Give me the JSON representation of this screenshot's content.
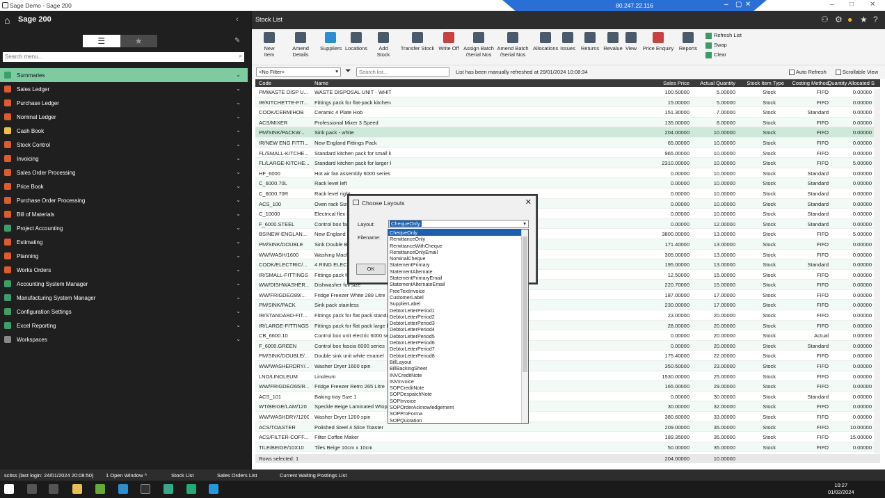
{
  "window": {
    "title": "Sage Demo - Sage 200",
    "ip": "80.247.22.116"
  },
  "sidebar": {
    "title": "Sage 200",
    "search_placeholder": "Search menu...",
    "items": [
      {
        "label": "Summaries",
        "color": "#3aa06a"
      },
      {
        "label": "Sales Ledger",
        "color": "#e05a2a"
      },
      {
        "label": "Purchase Ledger",
        "color": "#e05a2a"
      },
      {
        "label": "Nominal Ledger",
        "color": "#e05a2a"
      },
      {
        "label": "Cash Book",
        "color": "#f0c040"
      },
      {
        "label": "Stock Control",
        "color": "#e05a2a"
      },
      {
        "label": "Invoicing",
        "color": "#e05a2a"
      },
      {
        "label": "Sales Order Processing",
        "color": "#e05a2a"
      },
      {
        "label": "Price Book",
        "color": "#e05a2a"
      },
      {
        "label": "Purchase Order Processing",
        "color": "#e05a2a"
      },
      {
        "label": "Bill of Materials",
        "color": "#e05a2a"
      },
      {
        "label": "Project Accounting",
        "color": "#3aa06a"
      },
      {
        "label": "Estimating",
        "color": "#e05a2a"
      },
      {
        "label": "Planning",
        "color": "#e05a2a"
      },
      {
        "label": "Works Orders",
        "color": "#e05a2a"
      },
      {
        "label": "Accounting System Manager",
        "color": "#3aa06a"
      },
      {
        "label": "Manufacturing System Manager",
        "color": "#3aa06a"
      },
      {
        "label": "Configuration Settings",
        "color": "#3aa06a"
      },
      {
        "label": "Excel Reporting",
        "color": "#3aa06a"
      },
      {
        "label": "Workspaces",
        "color": "#888888"
      }
    ]
  },
  "main": {
    "title": "Stock List",
    "toolbar": [
      "New Item",
      "Amend Details",
      "Suppliers",
      "Locations",
      "Add Stock",
      "Transfer Stock",
      "Write Off",
      "Assign Batch /Serial Nos",
      "Amend Batch /Serial Nos",
      "Allocations",
      "Issues",
      "Returns",
      "Revalue",
      "View",
      "Price Enquiry",
      "Reports"
    ],
    "side_actions": [
      "Refresh List",
      "Swap",
      "Clear"
    ],
    "filter": "<No Filter>",
    "search_placeholder": "Search list...",
    "refresh_info": "List has been manually refreshed at 29/01/2024 10:08:34",
    "auto_refresh": "Auto Refresh",
    "scrollable_view": "Scrollable View"
  },
  "grid": {
    "headers": [
      "Code",
      "Name",
      "Sales Price",
      "Actual Quantity",
      "Stock Item Type",
      "Costing Method",
      "Quantity Allocated S"
    ],
    "rows": [
      [
        "PMWASTE DISP U...",
        "WASTE DISPOSAL UNIT - WHITE",
        "100.50000",
        "5.00000",
        "Stock",
        "FIFO",
        "0.00000"
      ],
      [
        "IR/KITCHETTE-FIT...",
        "Fittings pack for flat-pack kitchenette",
        "15.00000",
        "5.00000",
        "Stock",
        "FIFO",
        "0.00000"
      ],
      [
        "COOK/CERM/HOB",
        "Ceramic 4 Plate Hob",
        "151.30000",
        "7.00000",
        "Stock",
        "Standard",
        "0.00000"
      ],
      [
        "ACS/MIXER",
        "Professional Mixer 3 Speed",
        "135.00000",
        "8.00000",
        "Stock",
        "FIFO",
        "0.00000"
      ],
      [
        "PM/SINK/PACKW...",
        "Sink pack - white",
        "204.00000",
        "10.00000",
        "Stock",
        "FIFO",
        "0.00000"
      ],
      [
        "IR/NEW ENG FITTI...",
        "New England Fittings Pack",
        "65.00000",
        "10.00000",
        "Stock",
        "FIFO",
        "0.00000"
      ],
      [
        "FL/SMALL-KITCHE...",
        "Standard kitchen pack for small kitchen",
        "965.00000",
        "10.00000",
        "Stock",
        "FIFO",
        "0.00000"
      ],
      [
        "FL/LARGE-KITCHE...",
        "Standard kitchen pack for larger kitchens",
        "2310.00000",
        "10.00000",
        "Stock",
        "FIFO",
        "5.00000"
      ],
      [
        "HF_6000",
        "Hot air fan assembly 6000 series",
        "0.00000",
        "10.00000",
        "Stock",
        "Standard",
        "0.00000"
      ],
      [
        "C_6000.70L",
        "Rack level left",
        "0.00000",
        "10.00000",
        "Stock",
        "Standard",
        "0.00000"
      ],
      [
        "C_6000.70R",
        "Rack level right",
        "0.00000",
        "10.00000",
        "Stock",
        "Standard",
        "0.00000"
      ],
      [
        "ACS_100",
        "Oven rack Size",
        "0.00000",
        "10.00000",
        "Stock",
        "Standard",
        "0.00000"
      ],
      [
        "C_10000",
        "Electrical flex 3",
        "0.00000",
        "10.00000",
        "Stock",
        "Standard",
        "0.00000"
      ],
      [
        "F_6000.STEEL",
        "Control box fa",
        "0.00000",
        "12.00000",
        "Stock",
        "Standard",
        "0.00000"
      ],
      [
        "BS/NEW-ENGLAN...",
        "New England B",
        "3800.00000",
        "13.00000",
        "Stock",
        "FIFO",
        "5.00000"
      ],
      [
        "PM/SINK/DOUBLE",
        "Sink Double B",
        "171.40000",
        "13.00000",
        "Stock",
        "FIFO",
        "0.00000"
      ],
      [
        "WW/WASH/1600",
        "Washing Mach",
        "305.00000",
        "13.00000",
        "Stock",
        "FIFO",
        "0.00000"
      ],
      [
        "COOK/ELECTRIC/...",
        "4 RING ELECT",
        "195.00000",
        "13.00000",
        "Stock",
        "Standard",
        "0.00000"
      ],
      [
        "IR/SMALL-FITTINGS",
        "Fittings pack fo",
        "12.50000",
        "15.00000",
        "Stock",
        "FIFO",
        "0.00000"
      ],
      [
        "WW/DISHWASHER...",
        "Dishwasher full size",
        "220.70000",
        "15.00000",
        "Stock",
        "FIFO",
        "0.00000"
      ],
      [
        "WW/FRIGDE/289/...",
        "Fridge Freezer White 289 Litre",
        "187.00000",
        "17.00000",
        "Stock",
        "FIFO",
        "0.00000"
      ],
      [
        "PM/SINK/PACK",
        "Sink pack stainless",
        "230.00000",
        "17.00000",
        "Stock",
        "FIFO",
        "0.00000"
      ],
      [
        "IR/STANDARD-FIT...",
        "Fittings pack for flat pack standa",
        "23.00000",
        "20.00000",
        "Stock",
        "FIFO",
        "0.00000"
      ],
      [
        "IR/LARGE-FITTINGS",
        "Fittings pack for flat pack large k",
        "28.00000",
        "20.00000",
        "Stock",
        "FIFO",
        "0.00000"
      ],
      [
        "CB_6600.10",
        "Control box unit electric 6000 se",
        "0.00000",
        "20.00000",
        "Stock",
        "Actual",
        "0.00000"
      ],
      [
        "F_6000.GREEN",
        "Control box fascia 6000 series",
        "0.00000",
        "20.00000",
        "Stock",
        "Standard",
        "0.00000"
      ],
      [
        "PM/SINK/DOUBLE/...",
        "Double sink unit white enamel",
        "175.40000",
        "22.00000",
        "Stock",
        "FIFO",
        "0.00000"
      ],
      [
        "WW/WASHERDRY/...",
        "Washer Dryer 1600 spin",
        "350.50000",
        "23.00000",
        "Stock",
        "FIFO",
        "0.00000"
      ],
      [
        "LNO/LINOLEUM",
        "Linoleum",
        "1530.00000",
        "25.00000",
        "Stock",
        "FIFO",
        "0.00000"
      ],
      [
        "WW/FRIGDE/265/R...",
        "Fridge Freezer Retro 265 Litre",
        "165.00000",
        "29.00000",
        "Stock",
        "FIFO",
        "0.00000"
      ],
      [
        "ACS_101",
        "Baking tray Size 1",
        "0.00000",
        "30.00000",
        "Stock",
        "Standard",
        "0.00000"
      ],
      [
        "WT/BEIGE/LAM/120",
        "Speckle Beige Laminated Wtop",
        "30.00000",
        "32.00000",
        "Stock",
        "FIFO",
        "0.00000"
      ],
      [
        "WW/WASHDRY/1200",
        "Washer Dryer 1200 spin",
        "380.60000",
        "33.00000",
        "Stock",
        "FIFO",
        "0.00000"
      ],
      [
        "ACS/TOASTER",
        "Polished Steel 4 Slice Toaster",
        "209.00000",
        "35.00000",
        "Stock",
        "FIFO",
        "10.00000"
      ],
      [
        "ACS/FILTER-COFF...",
        "Filter Coffee Maker",
        "189.35000",
        "35.00000",
        "Stock",
        "FIFO",
        "15.00000"
      ],
      [
        "TILE/BEIGE/10X10",
        "Tiles Beige 10cm x 10cm",
        "50.00000",
        "35.00000",
        "Stock",
        "FIFO",
        "0.00000"
      ]
    ],
    "footer": {
      "rows_selected": "Rows selected: 1",
      "sales_price": "204.00000",
      "quantity": "10.00000"
    }
  },
  "dialog": {
    "title": "Choose Layouts",
    "layout_label": "Layout:",
    "layout_value": "ChequeOnly",
    "filename_label": "Filename:",
    "ok": "OK",
    "options": [
      "ChequeOnly",
      "RemittanceOnly",
      "RemittanceWithCheque",
      "RemittanceOnlyEmail",
      "NominalCheque",
      "StatementPrimary",
      "StatementAlternate",
      "StatementPrimaryEmail",
      "StatementAlternateEmail",
      "FreeTextInvoice",
      "CustomerLabel",
      "SupplierLabel",
      "DebtorLetterPeriod1",
      "DebtorLetterPeriod2",
      "DebtorLetterPeriod3",
      "DebtorLetterPeriod4",
      "DebtorLetterPeriod5",
      "DebtorLetterPeriod6",
      "DebtorLetterPeriod7",
      "DebtorLetterPeriod8",
      "BillLayout",
      "BillBackingSheet",
      "INVCreditNote",
      "INVInvoice",
      "SOPCreditNote",
      "SOPDespatchNote",
      "SOPInvoice",
      "SOPOrderAcknowledgement",
      "SOPProForma",
      "SOPQuotation"
    ]
  },
  "statusbar": {
    "login": "scitss (last login: 24/01/2024 20:08:50)",
    "windows": "1 Open Window ^",
    "tabs": [
      "Stock List",
      "Sales Orders List",
      "Current Waiting Postings List"
    ]
  },
  "taskbar": {
    "time": "10:27",
    "date": "01/02/2024"
  }
}
